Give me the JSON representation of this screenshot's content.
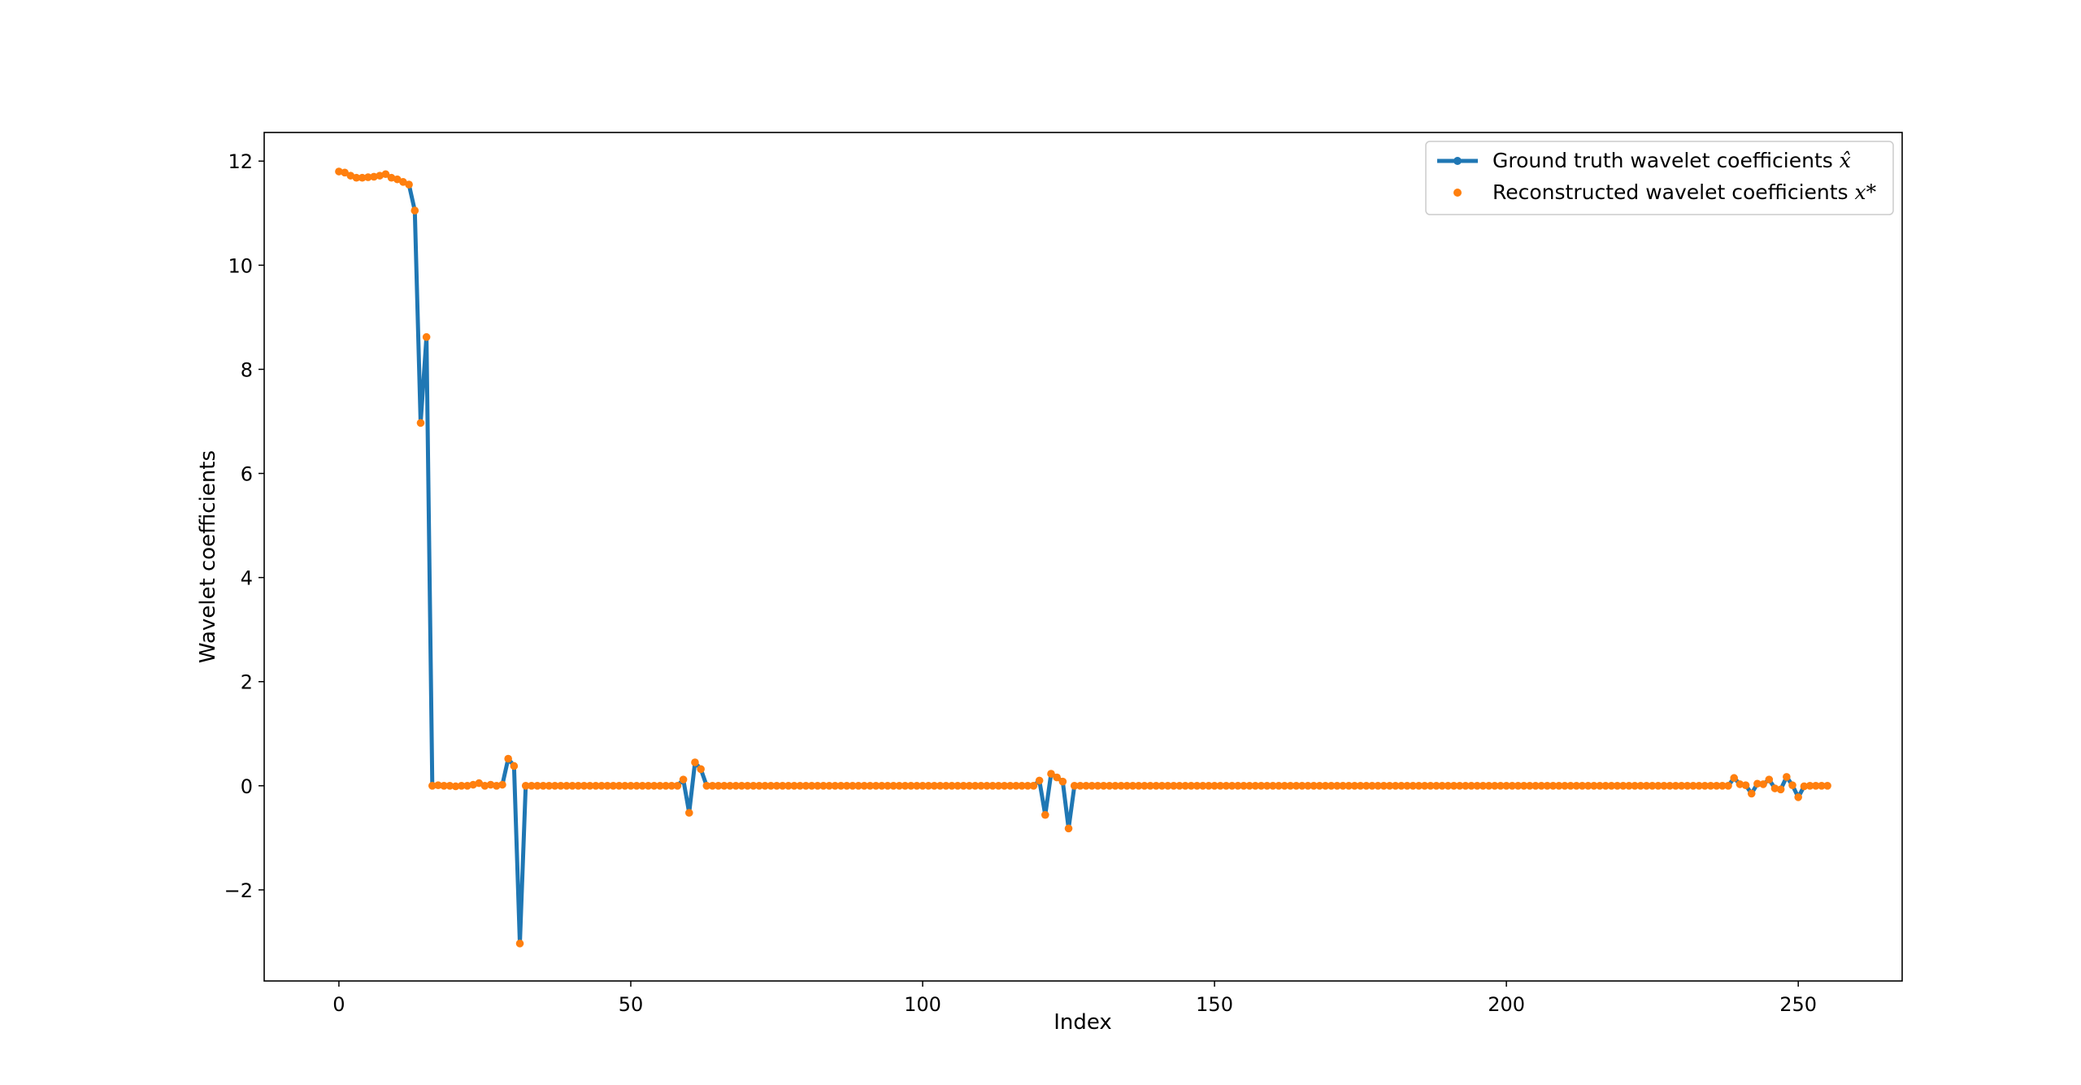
{
  "chart_data": {
    "type": "line",
    "title": "",
    "xlabel": "Index",
    "ylabel": "Wavelet coefficients",
    "xlim": [
      -12.8,
      267.8
    ],
    "ylim": [
      -3.75,
      12.55
    ],
    "xticks": [
      0,
      50,
      100,
      150,
      200,
      250
    ],
    "xtick_labels": [
      "0",
      "50",
      "100",
      "150",
      "200",
      "250"
    ],
    "yticks": [
      -2,
      0,
      2,
      4,
      6,
      8,
      10,
      12
    ],
    "ytick_labels": [
      "−2",
      "0",
      "2",
      "4",
      "6",
      "8",
      "10",
      "12"
    ],
    "grid": false,
    "legend_position": "top-right",
    "colors": {
      "ground_truth": "#1f77b4",
      "reconstructed": "#ff7f0e",
      "frame": "#000000"
    },
    "n_points": 256,
    "head_values": [
      11.8,
      11.78,
      11.72,
      11.68,
      11.68,
      11.69,
      11.7,
      11.72,
      11.75,
      11.68,
      11.65,
      11.6,
      11.55,
      11.05,
      6.97,
      8.62
    ],
    "sparse_values": [
      [
        17,
        0.01
      ],
      [
        20,
        -0.01
      ],
      [
        23,
        0.02
      ],
      [
        24,
        0.05
      ],
      [
        26,
        0.02
      ],
      [
        28,
        0.02
      ],
      [
        29,
        0.52
      ],
      [
        30,
        0.38
      ],
      [
        31,
        -3.03
      ],
      [
        32,
        0.0
      ],
      [
        59,
        0.12
      ],
      [
        60,
        -0.52
      ],
      [
        61,
        0.45
      ],
      [
        62,
        0.32
      ],
      [
        120,
        0.1
      ],
      [
        121,
        -0.56
      ],
      [
        122,
        0.23
      ],
      [
        123,
        0.16
      ],
      [
        124,
        0.08
      ],
      [
        125,
        -0.82
      ],
      [
        239,
        0.15
      ],
      [
        240,
        0.03
      ],
      [
        241,
        0.01
      ],
      [
        242,
        -0.15
      ],
      [
        243,
        0.04
      ],
      [
        244,
        0.03
      ],
      [
        245,
        0.12
      ],
      [
        246,
        -0.05
      ],
      [
        247,
        -0.07
      ],
      [
        248,
        0.17
      ],
      [
        249,
        0.01
      ],
      [
        250,
        -0.22
      ],
      [
        251,
        -0.01
      ],
      [
        252,
        0.0
      ],
      [
        253,
        0.0
      ],
      [
        254,
        0.0
      ],
      [
        255,
        0.0
      ]
    ],
    "series": [
      {
        "name": "Ground truth wavelet coefficients",
        "math": "x̂",
        "style": "line-with-markers"
      },
      {
        "name": "Reconstructed wavelet coefficients",
        "math": "x*",
        "style": "markers"
      }
    ]
  }
}
